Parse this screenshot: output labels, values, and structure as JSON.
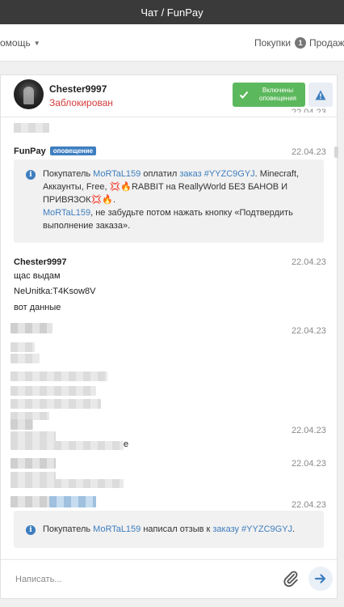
{
  "window": {
    "title": "Чат / FunPay"
  },
  "nav": {
    "help": "омощь",
    "purchases": "Покупки",
    "purchases_count": "1",
    "sales": "Продажи"
  },
  "chat": {
    "username": "Chester9997",
    "status": "Заблокирован",
    "notify_label": "Включены оповещения",
    "status_color": "#d43c3c",
    "accent_color": "#5cb85c",
    "link_color": "#3e7ebf"
  },
  "messages": {
    "m1": {
      "author": "FunPay",
      "tag": "оповещение",
      "time": "22.04.23",
      "buyer_prefix": "Покупатель ",
      "buyer": "MoRTaL159",
      "paid": " оплатил ",
      "order_link": "заказ #YYZC9GYJ",
      "product": ". Minecraft, Аккаунты, Free, 💢🔥RABBIT на ReallyWorld БЕЗ БАНОВ И ПРИВЯЗОК💢🔥.",
      "reminder_user": "MoRTaL159",
      "reminder": ", не забудьте потом нажать кнопку «Подтвердить выполнение заказа»."
    },
    "m2": {
      "author": "Chester9997",
      "time": "22.04.23",
      "lines": [
        "щас выдам",
        "NeUnitka:T4Ksow8V",
        "вот данные"
      ]
    },
    "m3": {
      "time": "22.04.23"
    },
    "m4": {
      "time": "22.04.23",
      "tail": "е"
    },
    "m5": {
      "time": "22.04.23"
    },
    "m6": {
      "time": "22.04.23",
      "buyer_prefix": "Покупатель ",
      "buyer": "MoRTaL159",
      "wrote": " написал отзыв к ",
      "order_link": "заказу #YYZC9GYJ",
      "end": "."
    },
    "partial_time": "22.04.23"
  },
  "compose": {
    "placeholder": "Написать..."
  },
  "icons": {
    "attach": "paperclip-icon",
    "send": "arrow-right-icon",
    "warning": "warning-icon",
    "check": "check-icon",
    "info": "info-icon"
  }
}
